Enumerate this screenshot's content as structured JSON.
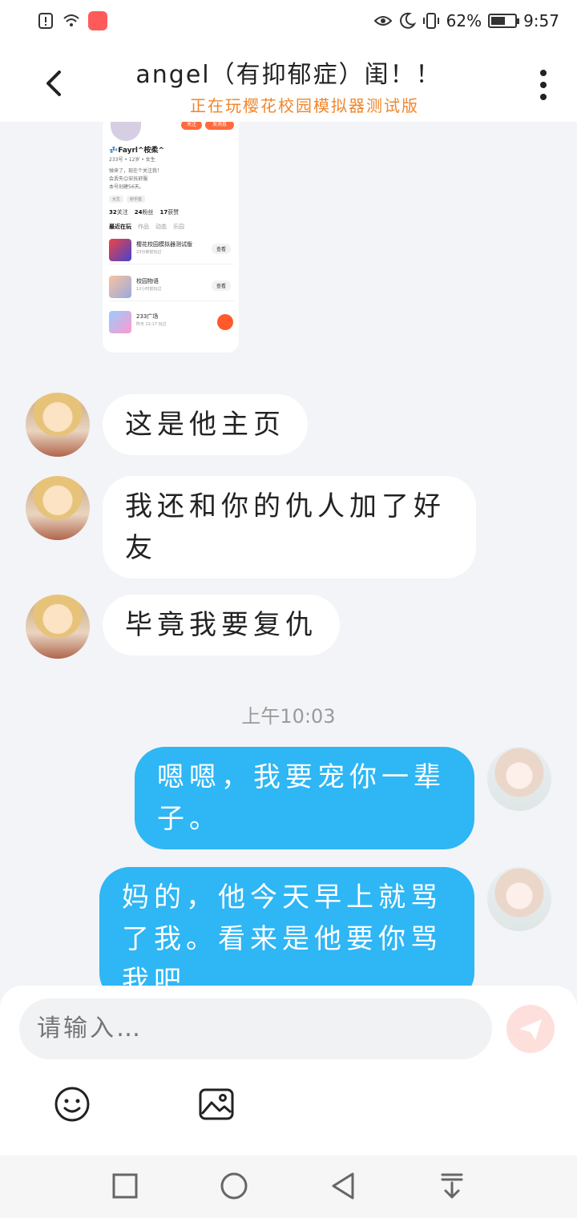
{
  "status_bar": {
    "battery_percent": "62%",
    "battery_level": 0.62,
    "time": "9:57",
    "icons": [
      "alert-icon",
      "wifi-icon",
      "app-notification-icon",
      "eye-icon",
      "moon-icon",
      "vibrate-icon",
      "battery-icon"
    ]
  },
  "header": {
    "title": "angel（有抑郁症）闺！！",
    "subtitle": "正在玩樱花校园模拟器测试版"
  },
  "shared_screenshot": {
    "follow_label": "关注",
    "chat_label": "发消息",
    "name": "💤Fayrl^桉柔^",
    "meta_line": "233号 • 12岁 • 女生",
    "bio_lines": [
      "弹来了，现在个关注我！",
      "会丢失😊安抚舒服",
      "本号创建56天。"
    ],
    "tags": [
      "女生",
      "射手座"
    ],
    "stats": [
      {
        "count": "32",
        "label": "关注"
      },
      {
        "count": "24",
        "label": "粉丝"
      },
      {
        "count": "17",
        "label": "获赞"
      }
    ],
    "tabs": [
      "最近在玩",
      "作品",
      "动态",
      "乐园"
    ],
    "games": [
      {
        "title": "樱花校园模拟器测试版",
        "sub": "23分钟前玩过",
        "action": "查看"
      },
      {
        "title": "校园物语",
        "sub": "12小时前玩过",
        "action": "查看"
      },
      {
        "title": "233广场",
        "sub": "昨天 22:17 玩过",
        "action": ""
      }
    ]
  },
  "messages": [
    {
      "side": "in",
      "text": "这是他主页"
    },
    {
      "side": "in",
      "text": "我还和你的仇人加了好友"
    },
    {
      "side": "in",
      "text": "毕竟我要复仇"
    },
    {
      "side": "out",
      "text": "嗯嗯，我要宠你一辈子。"
    },
    {
      "side": "out",
      "text": "妈的，他今天早上就骂了我。看来是他要你骂我吧"
    }
  ],
  "timestamp": "上午10:03",
  "input": {
    "placeholder": "请输入…"
  },
  "colors": {
    "accent": "#2eb6f5",
    "subtitle": "#f0862b",
    "send_disabled": "#fde0dc"
  }
}
